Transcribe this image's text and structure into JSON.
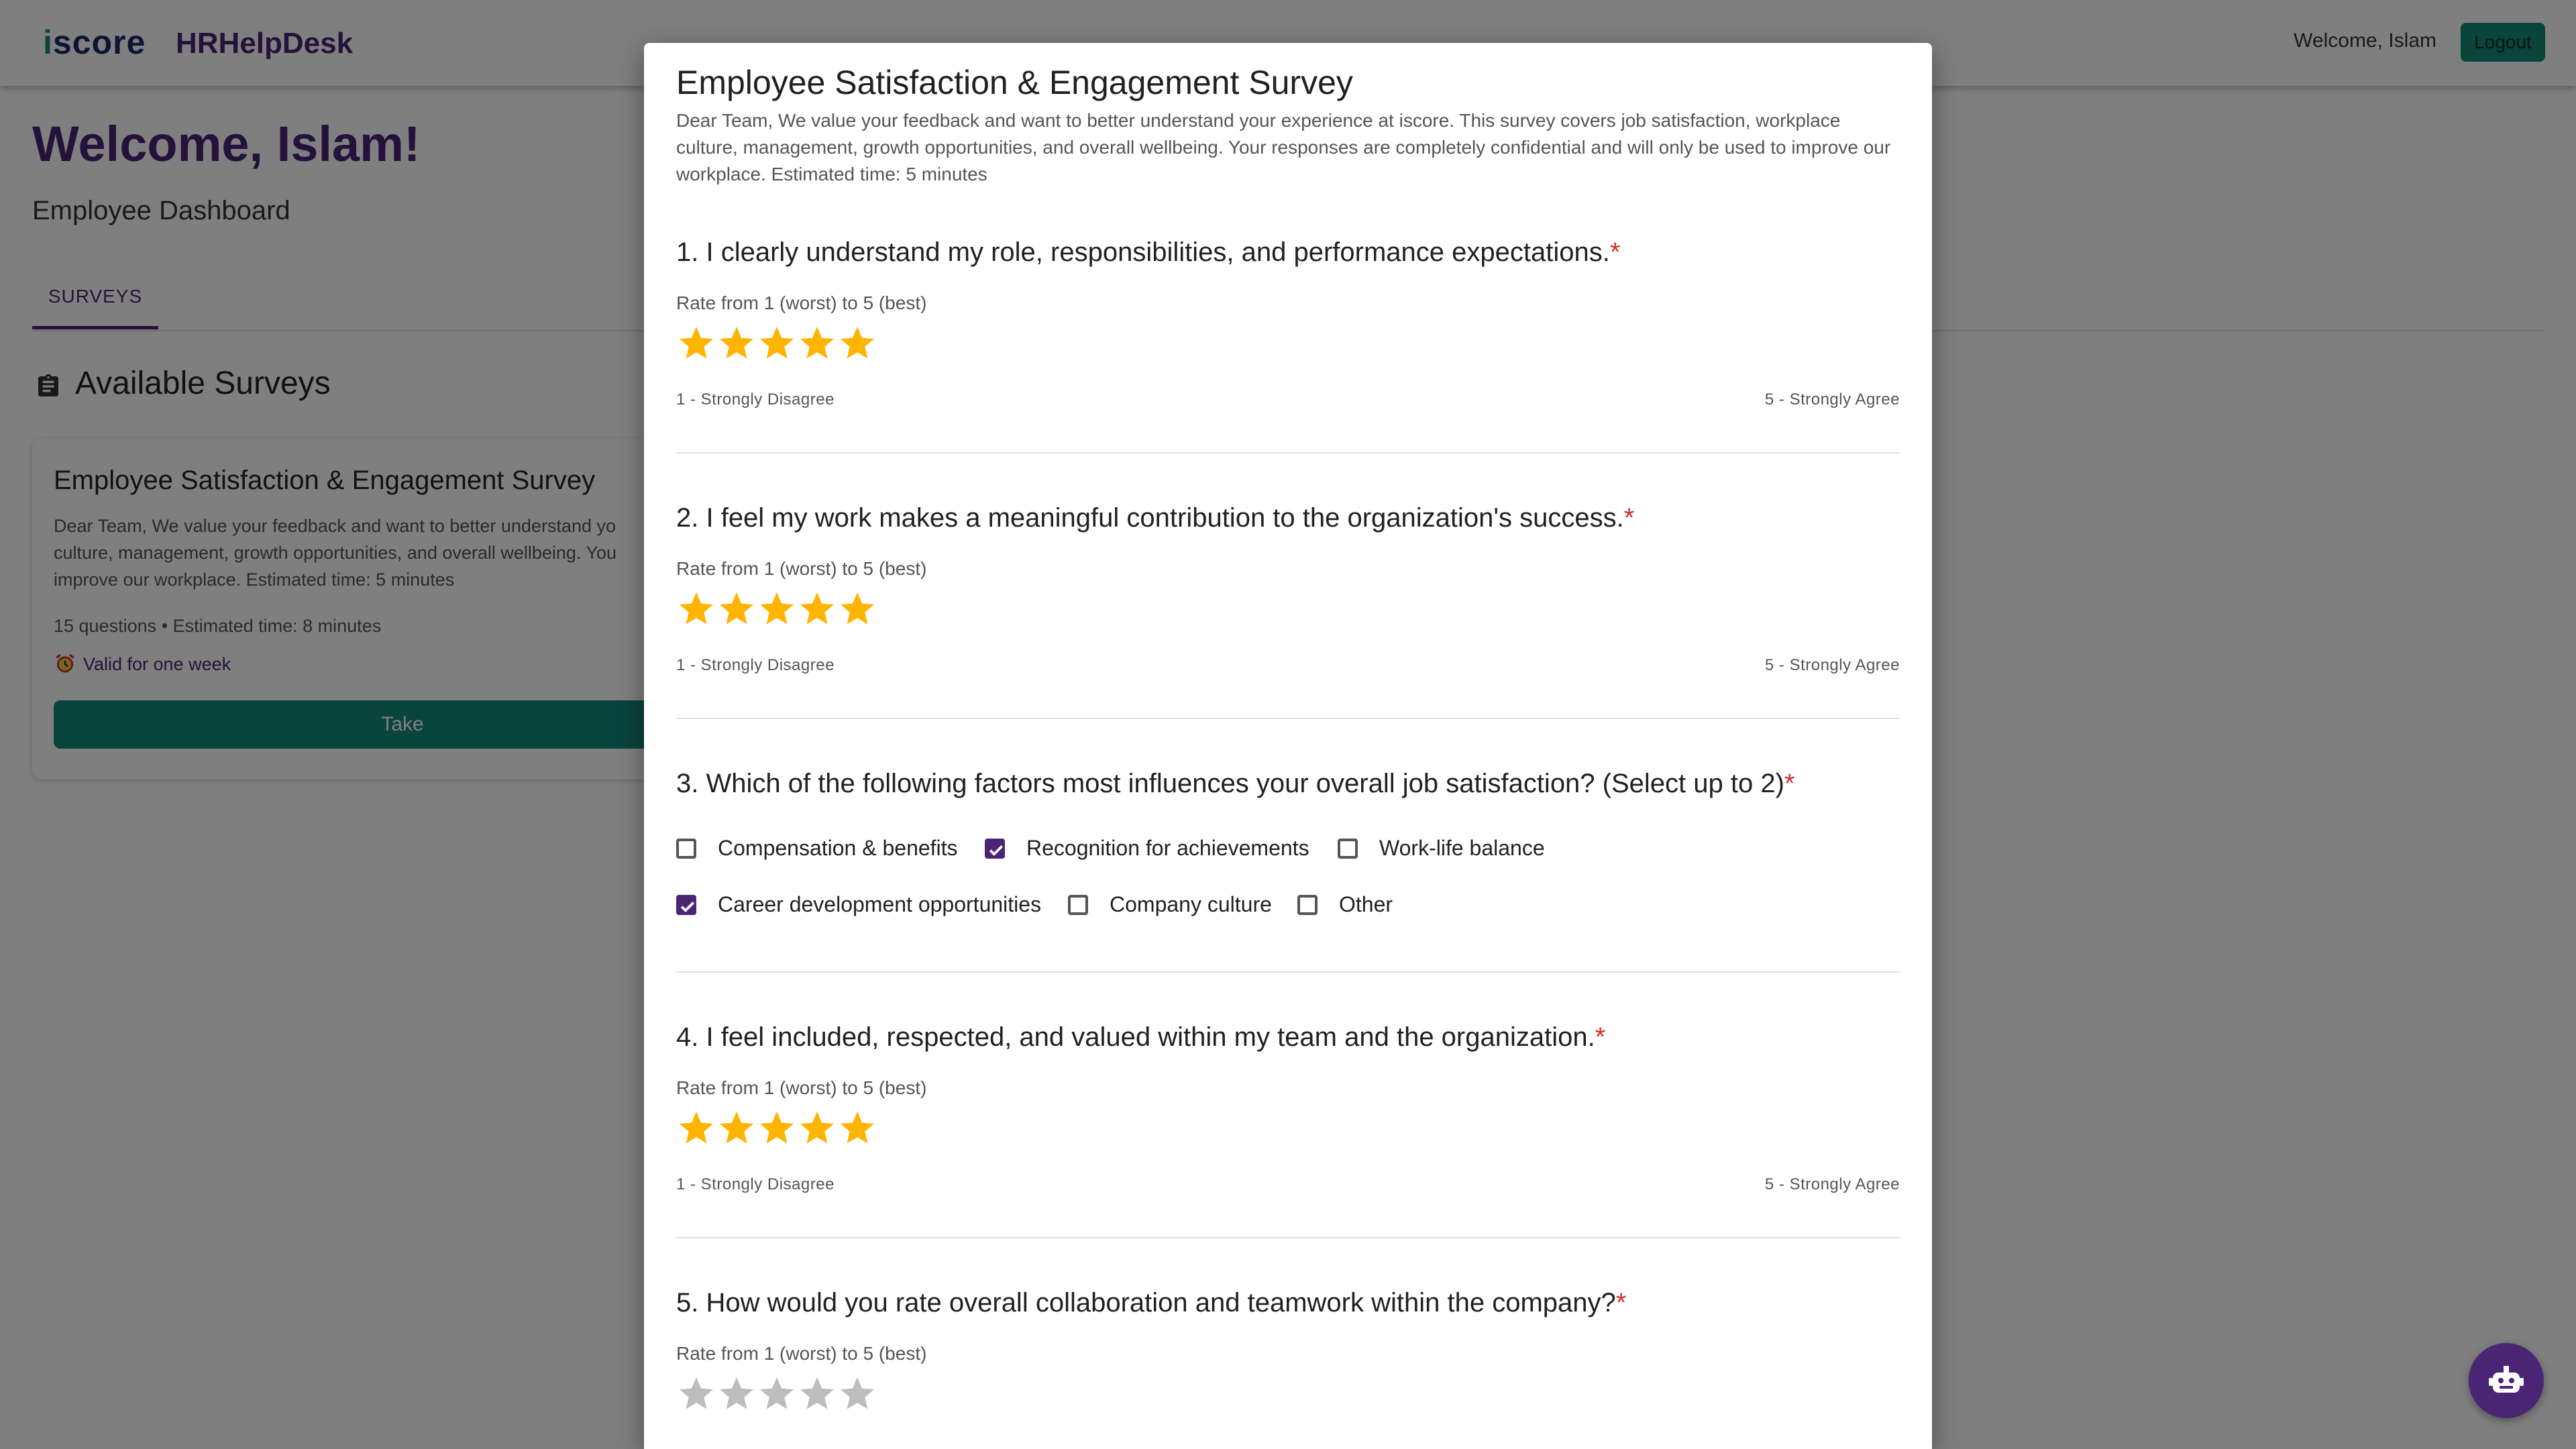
{
  "app": {
    "logo": "iscore",
    "name": "HRHelpDesk",
    "welcome": "Welcome, Islam",
    "logout_label": "Logout"
  },
  "dashboard": {
    "heading": "Welcome, Islam!",
    "subheading": "Employee Dashboard",
    "tab": "SURVEYS",
    "section_title": "Available Surveys",
    "card": {
      "title": "Employee Satisfaction & Engagement Survey",
      "description": "Dear Team, We value your feedback and want to better understand yo culture, management, growth opportunities, and overall wellbeing. You improve our workplace. Estimated time: 5 minutes",
      "meta": "15 questions • Estimated time: 8 minutes",
      "valid": "Valid for one week",
      "take_label": "Take"
    }
  },
  "dialog": {
    "title": "Employee Satisfaction & Engagement Survey",
    "description": "Dear Team, We value your feedback and want to better understand your experience at iscore. This survey covers job satisfaction, workplace culture, management, growth opportunities, and overall wellbeing. Your responses are completely confidential and will only be used to improve our workplace. Estimated time: 5 minutes",
    "required_mark": "*",
    "rating_hint": "Rate from 1 (worst) to 5 (best)",
    "scale_low": "1 - Strongly Disagree",
    "scale_high": "5 - Strongly Agree",
    "questions": [
      {
        "title": "1. I clearly understand my role, responsibilities, and performance expectations.",
        "rating": 5,
        "max": 5
      },
      {
        "title": "2. I feel my work makes a meaningful contribution to the organization's success.",
        "rating": 5,
        "max": 5
      },
      {
        "title": "3. Which of the following factors most influences your overall job satisfaction? (Select up to 2)",
        "options": [
          {
            "label": "Compensation & benefits",
            "checked": false
          },
          {
            "label": "Recognition for achievements",
            "checked": true
          },
          {
            "label": "Work-life balance",
            "checked": false
          },
          {
            "label": "Career development opportunities",
            "checked": true
          },
          {
            "label": "Company culture",
            "checked": false
          },
          {
            "label": "Other",
            "checked": false
          }
        ]
      },
      {
        "title": "4. I feel included, respected, and valued within my team and the organization.",
        "rating": 5,
        "max": 5
      },
      {
        "title": "5. How would you rate overall collaboration and teamwork within the company?",
        "rating": 0,
        "max": 5
      }
    ]
  },
  "colors": {
    "brand_purple": "#4a2576",
    "brand_teal": "#12897a",
    "star_filled": "#FFB400",
    "star_empty": "#BDBDBD",
    "required": "#d32f2f"
  },
  "icons": {
    "section": "clipboard-icon",
    "valid": "alarm-clock-icon",
    "fab": "robot-icon",
    "rating": "star-icon"
  }
}
